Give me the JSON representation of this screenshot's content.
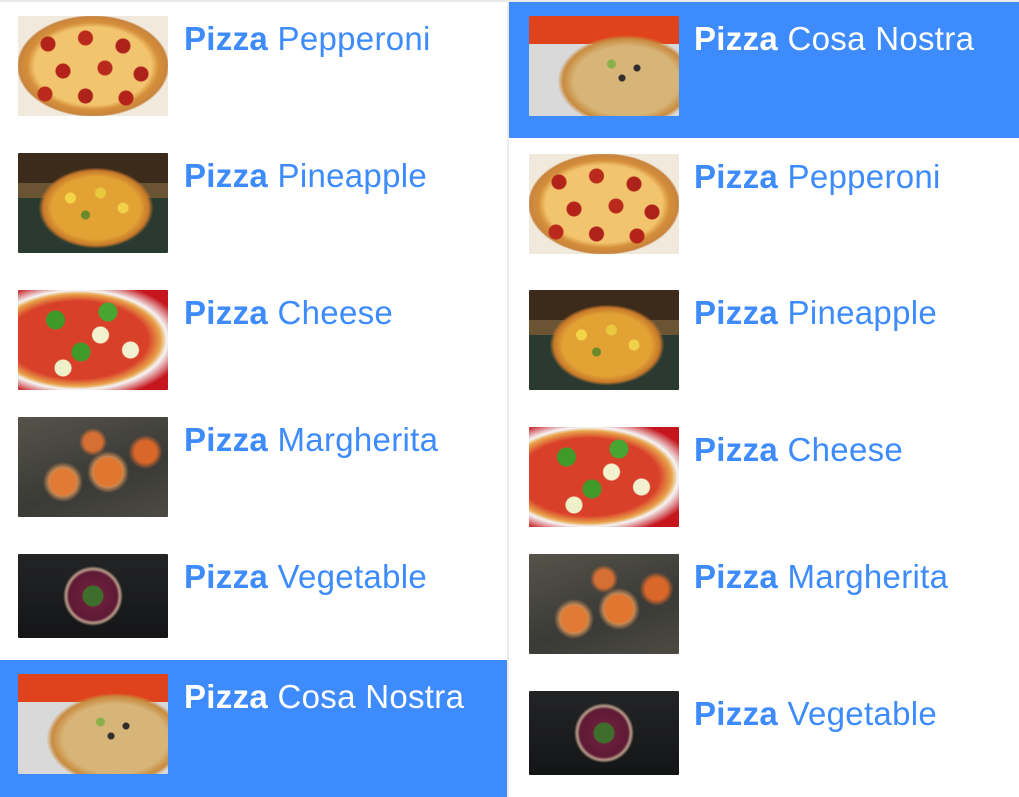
{
  "left_column": {
    "items": [
      {
        "bold": "Pizza",
        "rest": " Pepperoni",
        "image": "pepperoni-pizza-photo",
        "selected": false
      },
      {
        "bold": "Pizza",
        "rest": " Pineapple",
        "image": "pineapple-pizza-photo",
        "selected": false
      },
      {
        "bold": "Pizza",
        "rest": " Cheese",
        "image": "cheese-pizza-photo",
        "selected": false
      },
      {
        "bold": "Pizza",
        "rest": " Margherita",
        "image": "margherita-pizza-photo",
        "selected": false
      },
      {
        "bold": "Pizza",
        "rest": " Vegetable",
        "image": "vegetable-pizza-photo",
        "selected": false
      },
      {
        "bold": "Pizza",
        "rest": " Cosa Nostra",
        "image": "cosa-nostra-pizza-photo",
        "selected": true
      }
    ]
  },
  "right_column": {
    "items": [
      {
        "bold": "Pizza",
        "rest": " Cosa Nostra",
        "image": "cosa-nostra-pizza-photo",
        "selected": true
      },
      {
        "bold": "Pizza",
        "rest": " Pepperoni",
        "image": "pepperoni-pizza-photo",
        "selected": false
      },
      {
        "bold": "Pizza",
        "rest": " Pineapple",
        "image": "pineapple-pizza-photo",
        "selected": false
      },
      {
        "bold": "Pizza",
        "rest": " Cheese",
        "image": "cheese-pizza-photo",
        "selected": false
      },
      {
        "bold": "Pizza",
        "rest": " Margherita",
        "image": "margherita-pizza-photo",
        "selected": false
      },
      {
        "bold": "Pizza",
        "rest": " Vegetable",
        "image": "vegetable-pizza-photo",
        "selected": false
      }
    ]
  },
  "colors": {
    "accent": "#3d8bfd",
    "selected_text": "#ffffff",
    "background": "#ffffff"
  }
}
